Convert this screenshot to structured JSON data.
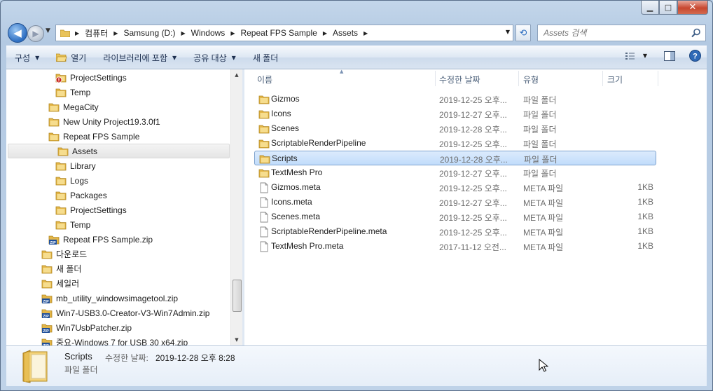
{
  "window": {
    "caption": {
      "minimize": "▁",
      "maximize": "□",
      "close": "✕"
    }
  },
  "address": {
    "crumbs": [
      "컴퓨터",
      "Samsung (D:)",
      "Windows",
      "Repeat FPS Sample",
      "Assets"
    ]
  },
  "search": {
    "placeholder": "Assets 검색"
  },
  "toolbar": {
    "organize": "구성",
    "open": "열기",
    "include_in_library": "라이브러리에 포함",
    "share_with": "공유 대상",
    "new_folder": "새 폴더"
  },
  "tree": {
    "items": [
      {
        "label": "ProjectSettings",
        "icon": "folder-warning-icon",
        "indent": 2
      },
      {
        "label": "Temp",
        "icon": "folder-icon",
        "indent": 2
      },
      {
        "label": "MegaCity",
        "icon": "folder-icon",
        "indent": 1
      },
      {
        "label": "New Unity Project19.3.0f1",
        "icon": "folder-icon",
        "indent": 1
      },
      {
        "label": "Repeat FPS Sample",
        "icon": "folder-icon",
        "indent": 1
      },
      {
        "label": "Assets",
        "icon": "folder-icon",
        "indent": 2,
        "selected": true
      },
      {
        "label": "Library",
        "icon": "folder-icon",
        "indent": 2
      },
      {
        "label": "Logs",
        "icon": "folder-icon",
        "indent": 2
      },
      {
        "label": "Packages",
        "icon": "folder-icon",
        "indent": 2
      },
      {
        "label": "ProjectSettings",
        "icon": "folder-icon",
        "indent": 2
      },
      {
        "label": "Temp",
        "icon": "folder-icon",
        "indent": 2
      },
      {
        "label": "Repeat FPS Sample.zip",
        "icon": "zip-icon",
        "indent": 1
      },
      {
        "label": "다운로드",
        "icon": "folder-icon",
        "indent": 0
      },
      {
        "label": "새 폴더",
        "icon": "folder-icon",
        "indent": 0
      },
      {
        "label": "세일러",
        "icon": "folder-icon",
        "indent": 0
      },
      {
        "label": "mb_utility_windowsimagetool.zip",
        "icon": "zip-icon",
        "indent": 0
      },
      {
        "label": "Win7-USB3.0-Creator-V3-Win7Admin.zip",
        "icon": "zip-icon",
        "indent": 0
      },
      {
        "label": "Win7UsbPatcher.zip",
        "icon": "zip-icon",
        "indent": 0
      },
      {
        "label": "중요-Windows 7 for USB 30 x64.zip",
        "icon": "zip-icon",
        "indent": 0
      }
    ]
  },
  "columns": {
    "name": "이름",
    "date": "수정한 날짜",
    "type": "유형",
    "size": "크기"
  },
  "files": [
    {
      "name": "Gizmos",
      "date": "2019-12-25 오후...",
      "type": "파일 폴더",
      "size": "",
      "icon": "folder-icon"
    },
    {
      "name": "Icons",
      "date": "2019-12-27 오후...",
      "type": "파일 폴더",
      "size": "",
      "icon": "folder-icon"
    },
    {
      "name": "Scenes",
      "date": "2019-12-28 오후...",
      "type": "파일 폴더",
      "size": "",
      "icon": "folder-icon"
    },
    {
      "name": "ScriptableRenderPipeline",
      "date": "2019-12-25 오후...",
      "type": "파일 폴더",
      "size": "",
      "icon": "folder-icon"
    },
    {
      "name": "Scripts",
      "date": "2019-12-28 오후...",
      "type": "파일 폴더",
      "size": "",
      "icon": "folder-icon",
      "selected": true
    },
    {
      "name": "TextMesh Pro",
      "date": "2019-12-27 오후...",
      "type": "파일 폴더",
      "size": "",
      "icon": "folder-icon"
    },
    {
      "name": "Gizmos.meta",
      "date": "2019-12-25 오후...",
      "type": "META 파일",
      "size": "1KB",
      "icon": "file-icon"
    },
    {
      "name": "Icons.meta",
      "date": "2019-12-27 오후...",
      "type": "META 파일",
      "size": "1KB",
      "icon": "file-icon"
    },
    {
      "name": "Scenes.meta",
      "date": "2019-12-25 오후...",
      "type": "META 파일",
      "size": "1KB",
      "icon": "file-icon"
    },
    {
      "name": "ScriptableRenderPipeline.meta",
      "date": "2019-12-25 오후...",
      "type": "META 파일",
      "size": "1KB",
      "icon": "file-icon"
    },
    {
      "name": "TextMesh Pro.meta",
      "date": "2017-11-12 오전...",
      "type": "META 파일",
      "size": "1KB",
      "icon": "file-icon"
    }
  ],
  "details": {
    "name": "Scripts",
    "modified_label": "수정한 날짜:",
    "modified_value": "2019-12-28 오후 8:28",
    "type": "파일 폴더"
  }
}
